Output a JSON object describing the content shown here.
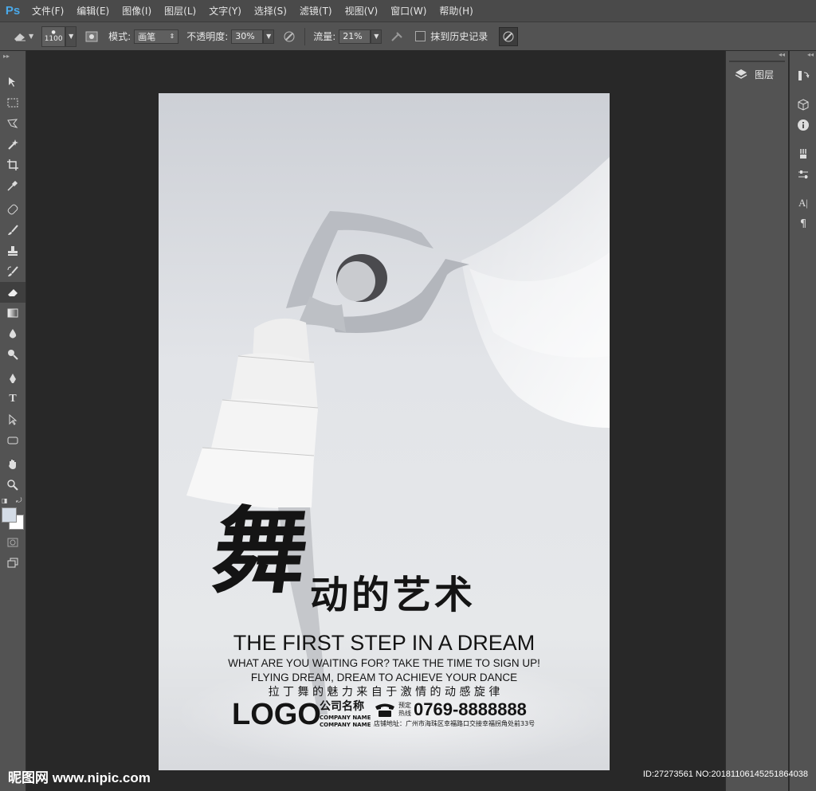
{
  "app": {
    "logo": "Ps"
  },
  "menu": [
    "文件(F)",
    "编辑(E)",
    "图像(I)",
    "图层(L)",
    "文字(Y)",
    "选择(S)",
    "滤镜(T)",
    "视图(V)",
    "窗口(W)",
    "帮助(H)"
  ],
  "options": {
    "brush_size": "1100",
    "mode_label": "模式:",
    "mode_value": "画笔",
    "opacity_label": "不透明度:",
    "opacity_value": "30%",
    "flow_label": "流量:",
    "flow_value": "21%",
    "erase_history_label": "抹到历史记录"
  },
  "panel": {
    "layers_label": "图层"
  },
  "poster": {
    "big_char": "舞",
    "title_rest": "动的艺术",
    "headline": "THE FIRST STEP IN A DREAM",
    "line1": "WHAT ARE YOU WAITING FOR? TAKE THE TIME TO SIGN UP!",
    "line2": "FLYING DREAM, DREAM TO ACHIEVE YOUR DANCE",
    "chinese_line": "拉 丁 舞 的 魅 力 来 自 于 激 情 的 动 感 旋 律",
    "logo": "LOGO",
    "company_cn": "公司名称",
    "company_en1": "COMPANY NAME",
    "company_en2": "COMPANY NAME",
    "hotline_label1": "预定",
    "hotline_label2": "热线",
    "phone": "0769-8888888",
    "address": "店铺地址：广州市海珠区幸福路口交接幸福拐角处前33号"
  },
  "watermark": {
    "site": "昵图网 www.nipic.com",
    "id": "ID:27273561 NO:20181106145251864038"
  },
  "colors": {
    "accent": "#4aa9e9",
    "ui_bg": "#535353",
    "canvas_bg": "#282828"
  }
}
